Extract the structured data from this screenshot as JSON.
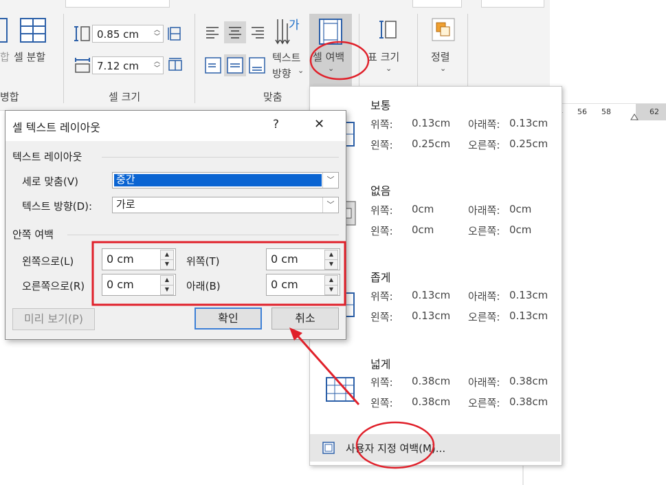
{
  "ribbon": {
    "merge_partial": "합",
    "split_cells": "셀 분할",
    "group_merge": "병합",
    "height_value": "0.85 cm",
    "width_value": "7.12 cm",
    "group_cell_size": "셀 크기",
    "text_direction_line1": "텍스트",
    "text_direction_line2": "방향",
    "cell_margins_label": "셀 여백",
    "table_size_label": "표 크기",
    "arrange_label": "정렬",
    "group_alignment": "맞춤",
    "direction_glyph": "가"
  },
  "ruler": {
    "ticks": [
      "4",
      "56",
      "58",
      "62"
    ]
  },
  "gallery": {
    "presets": [
      {
        "title": "보통",
        "top_label": "위쪽:",
        "top": "0.13cm",
        "bottom_label": "아래쪽:",
        "bottom": "0.13cm",
        "left_label": "왼쪽:",
        "left": "0.25cm",
        "right_label": "오른쪽:",
        "right": "0.25cm"
      },
      {
        "title": "없음",
        "top_label": "위쪽:",
        "top": "0cm",
        "bottom_label": "아래쪽:",
        "bottom": "0cm",
        "left_label": "왼쪽:",
        "left": "0cm",
        "right_label": "오른쪽:",
        "right": "0cm"
      },
      {
        "title": "좁게",
        "top_label": "위쪽:",
        "top": "0.13cm",
        "bottom_label": "아래쪽:",
        "bottom": "0.13cm",
        "left_label": "왼쪽:",
        "left": "0.13cm",
        "right_label": "오른쪽:",
        "right": "0.13cm"
      },
      {
        "title": "넓게",
        "top_label": "위쪽:",
        "top": "0.38cm",
        "bottom_label": "아래쪽:",
        "bottom": "0.38cm",
        "left_label": "왼쪽:",
        "left": "0.38cm",
        "right_label": "오른쪽:",
        "right": "0.38cm"
      }
    ],
    "custom": "사용자 지정 여백(M)..."
  },
  "dialog": {
    "title": "셀 텍스트 레이아웃",
    "help": "?",
    "close": "✕",
    "text_layout_group": "텍스트 레이아웃",
    "vertical_align_label": "세로 맞춤(V)",
    "vertical_align_value": "중간",
    "text_direction_label": "텍스트 방향(D):",
    "text_direction_value": "가로",
    "internal_margin_group": "안쪽 여백",
    "left_label": "왼쪽으로(L)",
    "left_value": "0 cm",
    "right_label": "오른쪽으로(R)",
    "right_value": "0 cm",
    "top_label": "위쪽(T)",
    "top_value": "0 cm",
    "bottom_label": "아래(B)",
    "bottom_value": "0 cm",
    "preview_button": "미리 보기(P)",
    "ok_button": "확인",
    "cancel_button": "취소"
  },
  "colors": {
    "annotation": "#e0202a",
    "selection": "#0a64d2",
    "accent_ribbon": "#1e6fc9"
  }
}
